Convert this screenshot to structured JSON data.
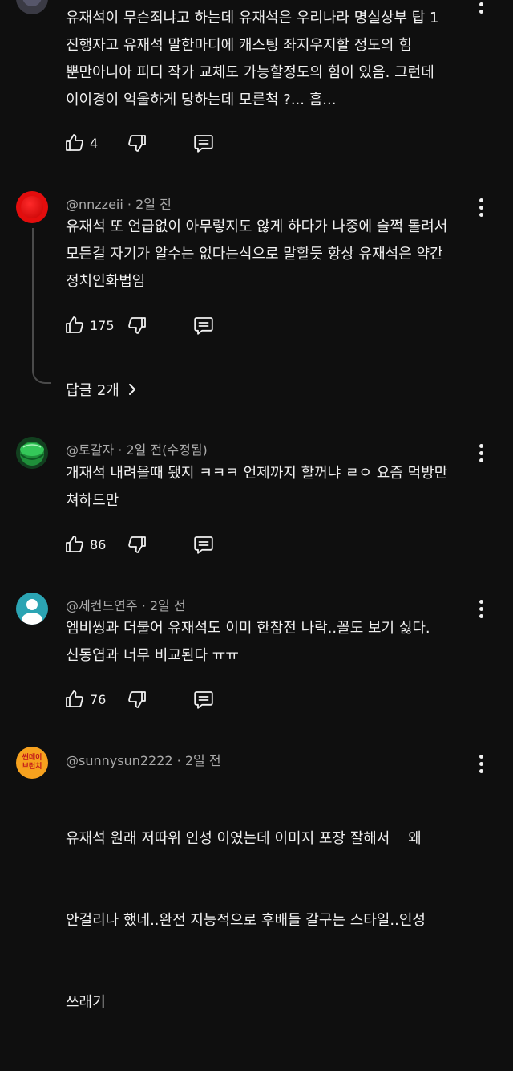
{
  "comments": [
    {
      "lines": [
        "유재석이 무슨죄냐고 하는데 유재석은 우리나라 명실상부 탑 1",
        "진행자고 유재석 말한마디에 캐스팅 좌지우지할 정도의 힘",
        "뿐만아니아 피디 작가 교체도 가능할정도의 힘이 있음. 그런데",
        "이이경이 억울하게 당하는데 모른척 ?... 흠..."
      ],
      "likes": "4"
    },
    {
      "author": "@nnzzeii",
      "time": "· 2일 전",
      "lines": [
        "유재석 또 언급없이 아무렇지도 않게 하다가 나중에 슬쩍 돌려서",
        "모든걸 자기가 알수는 없다는식으로 말할듯 항상 유재석은 약간",
        "정치인화법임"
      ],
      "likes": "175",
      "replies_label": "답글 2개"
    },
    {
      "author": "@토갈자",
      "time": "· 2일 전(수정됨)",
      "lines": [
        "개재석 내려올때 됐지 ㅋㅋㅋ 언제까지 할꺼냐 ㄹㅇ 요즘 먹방만",
        "쳐하드만"
      ],
      "likes": "86"
    },
    {
      "author": "@세컨드연주",
      "time": "· 2일 전",
      "lines": [
        "엠비씽과 더불어 유재석도 이미 한참전 나락..꼴도 보기 싫다.",
        "신동엽과 너무 비교된다 ㅠㅠ"
      ],
      "likes": "76"
    },
    {
      "author": "@sunnysun2222",
      "time": "· 2일 전",
      "avatar_text": [
        "썬데이",
        "브런치"
      ],
      "lines": [
        "유재석 원래 저따위 인성 이였는데 이미지 포장 잘해서    왜",
        "안걸리나 했네..완전 지능적으로 후배들 갈구는 스타일..인성",
        "쓰래기"
      ]
    }
  ],
  "colors": {
    "background": "#0f0f0f",
    "text": "#f1f1f1",
    "meta": "#aaaaaa",
    "avatar_red": "#e30d0d",
    "avatar_teal": "#2ba4b3",
    "avatar_orange": "#f6a11e"
  },
  "icons": [
    "thumbs-up-icon",
    "thumbs-down-icon",
    "reply-icon",
    "more-vert-icon",
    "chevron-right-icon"
  ]
}
